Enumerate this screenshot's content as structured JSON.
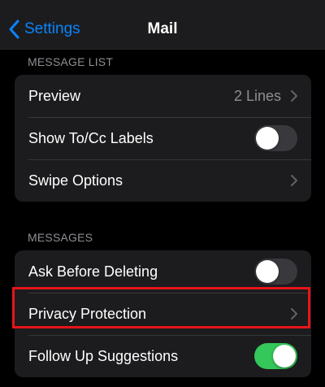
{
  "nav": {
    "back_label": "Settings",
    "title": "Mail"
  },
  "sections": [
    {
      "header": "MESSAGE LIST",
      "rows": [
        {
          "label": "Preview",
          "value": "2 Lines",
          "accessory": "chevron"
        },
        {
          "label": "Show To/Cc Labels",
          "accessory": "toggle",
          "toggle_on": false
        },
        {
          "label": "Swipe Options",
          "accessory": "chevron"
        }
      ]
    },
    {
      "header": "MESSAGES",
      "rows": [
        {
          "label": "Ask Before Deleting",
          "accessory": "toggle",
          "toggle_on": false
        },
        {
          "label": "Privacy Protection",
          "accessory": "chevron",
          "highlighted": true
        },
        {
          "label": "Follow Up Suggestions",
          "accessory": "toggle",
          "toggle_on": true
        }
      ]
    }
  ],
  "colors": {
    "accent": "#0a84ff",
    "toggle_on": "#34c759",
    "highlight_border": "#e6141b"
  },
  "icons": {
    "back": "chevron-left-icon",
    "disclosure": "chevron-right-icon"
  }
}
